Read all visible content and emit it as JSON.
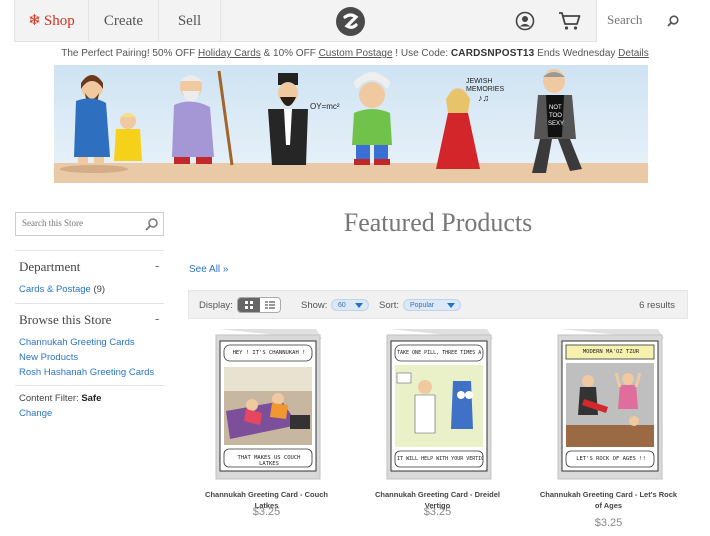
{
  "nav": {
    "shop_label": "Shop",
    "create_label": "Create",
    "sell_label": "Sell",
    "search_placeholder": "Search",
    "logo_icon": "zazzle-logo-icon",
    "account_icon": "account-icon",
    "cart_icon": "cart-icon",
    "accent_color": "#d6331f"
  },
  "promo": {
    "text_1": "The Perfect Pairing! 50% OFF ",
    "holiday_link": "Holiday Cards",
    "text_2": " & 10% OFF ",
    "postage_link": "Custom Postage",
    "text_3": " !   Use Code: ",
    "code": "CARDSNPOST13",
    "text_4": "  Ends Wednesday  ",
    "details_link": "Details"
  },
  "banner": {
    "cartoon_labels": [
      "OY=mc²",
      "JEWISH MEMORIES",
      "NOT TOO SEXY"
    ]
  },
  "sidebar": {
    "search_placeholder": "Search this Store",
    "department_heading": "Department",
    "department_toggle": "-",
    "department_link": "Cards & Postage",
    "department_count": "(9)",
    "browse_heading": "Browse this Store",
    "browse_toggle": "-",
    "browse_links": [
      "Channukah Greeting Cards",
      "New Products",
      "Rosh Hashanah Greeting Cards"
    ],
    "filter_label": "Content Filter:",
    "filter_value": "Safe",
    "filter_change": "Change"
  },
  "main": {
    "title": "Featured Products",
    "see_all": "See All »",
    "display_label": "Display:",
    "show_label": "Show:",
    "show_value": "60",
    "sort_label": "Sort:",
    "sort_value": "Popular",
    "results": "6 results"
  },
  "products": [
    {
      "name": "Channukah Greeting Card - Couch Latkes",
      "price": "$3.25",
      "caption_top": "HEY ! IT'S CHANNUKAH !",
      "caption_bottom": "THAT MAKES US COUCH LATKES"
    },
    {
      "name": "Channukah Greeting Card - Dreidel Vertigo",
      "price": "$3.25",
      "caption_top": "TAKE ONE PILL, THREE TIMES A DAY.",
      "caption_bottom": "IT WILL HELP WITH YOUR VERTIGO"
    },
    {
      "name": "Channukah Greeting Card - Let's Rock of Ages",
      "price": "$3.25",
      "caption_top": "MODERN MA'OZ TZUR",
      "caption_bottom": "LET'S ROCK OF AGES !!"
    }
  ]
}
